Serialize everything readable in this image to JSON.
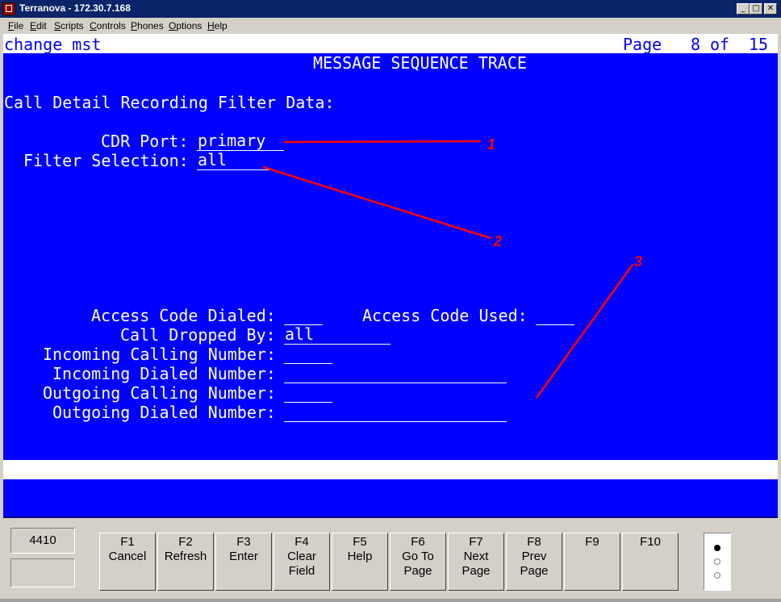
{
  "window": {
    "title": "Terranova - 172.30.7.168"
  },
  "menu": [
    "File",
    "Edit",
    "Scripts",
    "Controls",
    "Phones",
    "Options",
    "Help"
  ],
  "terminal": {
    "command": "change mst",
    "page_label": "Page",
    "page_current": "8",
    "page_of": "of",
    "page_total": "15",
    "heading": "MESSAGE SEQUENCE TRACE",
    "section": "Call Detail Recording Filter Data:",
    "cdr_port_label": "CDR Port:",
    "cdr_port_value": "primary",
    "filter_selection_label": "Filter Selection:",
    "filter_selection_value": "all",
    "access_code_dialed_label": "Access Code Dialed:",
    "access_code_dialed_value": "",
    "access_code_used_label": "Access Code Used:",
    "access_code_used_value": "",
    "call_dropped_by_label": "Call Dropped By:",
    "call_dropped_by_value": "all",
    "incoming_calling_label": "Incoming Calling Number:",
    "incoming_calling_value": "",
    "incoming_dialed_label": "Incoming Dialed Number:",
    "incoming_dialed_value": "",
    "outgoing_calling_label": "Outgoing Calling Number:",
    "outgoing_calling_value": "",
    "outgoing_dialed_label": "Outgoing Dialed Number:",
    "outgoing_dialed_value": ""
  },
  "annotations": [
    "1",
    "2",
    "3"
  ],
  "annotation_color": "#ff0000",
  "panel": {
    "terminal_type": "4410",
    "keys": [
      {
        "key": "F1",
        "line1": "Cancel",
        "line2": ""
      },
      {
        "key": "F2",
        "line1": "Refresh",
        "line2": ""
      },
      {
        "key": "F3",
        "line1": "Enter",
        "line2": ""
      },
      {
        "key": "F4",
        "line1": "Clear",
        "line2": "Field"
      },
      {
        "key": "F5",
        "line1": "Help",
        "line2": ""
      },
      {
        "key": "F6",
        "line1": "Go To",
        "line2": "Page"
      },
      {
        "key": "F7",
        "line1": "Next",
        "line2": "Page"
      },
      {
        "key": "F8",
        "line1": "Prev",
        "line2": "Page"
      },
      {
        "key": "F9",
        "line1": "",
        "line2": ""
      },
      {
        "key": "F10",
        "line1": "",
        "line2": ""
      }
    ]
  }
}
